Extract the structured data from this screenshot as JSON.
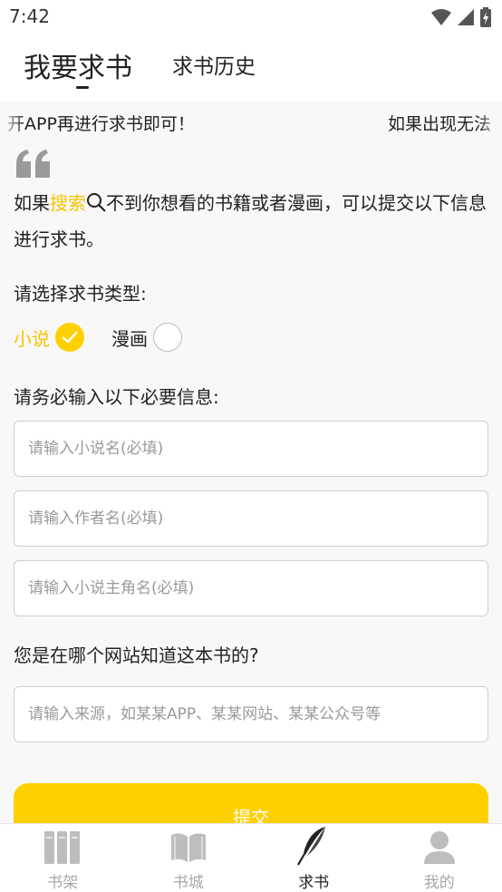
{
  "status_bar": {
    "time": "7:42"
  },
  "tabs": {
    "request_book": "我要求书",
    "request_history": "求书历史"
  },
  "marquee": {
    "text_a": "开APP再进行求书即可！",
    "text_b": "如果出现无法"
  },
  "intro": {
    "prefix": "如果",
    "search_word": "搜索",
    "suffix": "不到你想看的书籍或者漫画，可以提交以下信息进行求书。"
  },
  "type_section": {
    "label": "请选择求书类型:",
    "options": [
      {
        "label": "小说",
        "selected": true
      },
      {
        "label": "漫画",
        "selected": false
      }
    ]
  },
  "required_section": {
    "label": "请务必输入以下必要信息:",
    "fields": [
      {
        "placeholder": "请输入小说名(必填)",
        "value": ""
      },
      {
        "placeholder": "请输入作者名(必填)",
        "value": ""
      },
      {
        "placeholder": "请输入小说主角名(必填)",
        "value": ""
      }
    ]
  },
  "source_section": {
    "label": "您是在哪个网站知道这本书的?",
    "placeholder": "请输入来源，如某某APP、某某网站、某某公众号等"
  },
  "submit_label": "提交",
  "bottom_nav": [
    {
      "label": "书架",
      "icon": "bookshelf-icon",
      "active": false
    },
    {
      "label": "书城",
      "icon": "open-book-icon",
      "active": false
    },
    {
      "label": "求书",
      "icon": "quill-icon",
      "active": true
    },
    {
      "label": "我的",
      "icon": "user-icon",
      "active": false
    }
  ],
  "colors": {
    "accent": "#ffd000",
    "highlight_text": "#f5c400",
    "inactive_nav": "#a8a8a8"
  }
}
